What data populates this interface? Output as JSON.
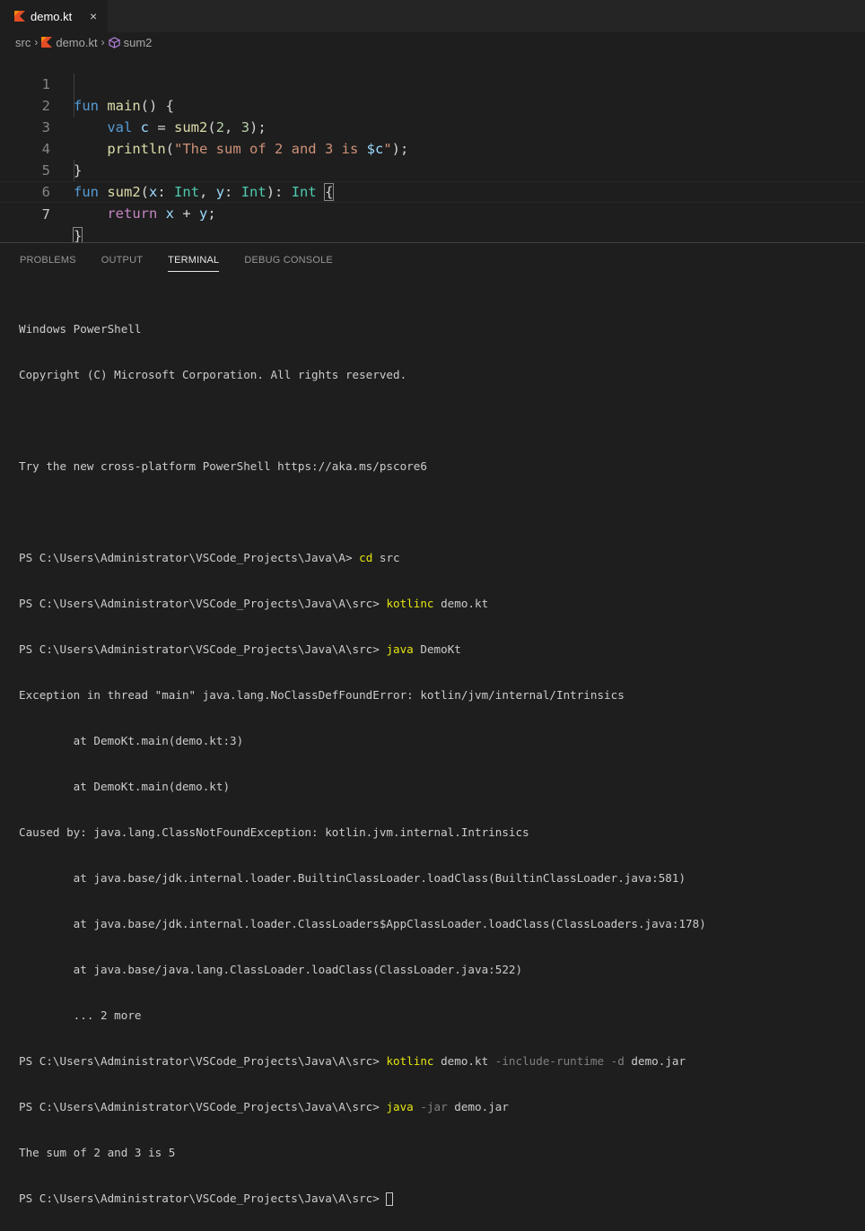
{
  "tab": {
    "title": "demo.kt",
    "close": "×"
  },
  "breadcrumb": {
    "folder": "src",
    "file": "demo.kt",
    "symbol": "sum2"
  },
  "editor": {
    "line_numbers": [
      "1",
      "2",
      "3",
      "4",
      "5",
      "6",
      "7"
    ],
    "tokens": {
      "l1_kw": "fun",
      "l1_fn": "main",
      "l1_rest": "() {",
      "l2_kw": "val",
      "l2_var": "c",
      "l2_eq": " = ",
      "l2_fn": "sum2",
      "l2_p1": "(",
      "l2_n1": "2",
      "l2_comma": ", ",
      "l2_n2": "3",
      "l2_end": ");",
      "l3_fn": "println",
      "l3_p": "(",
      "l3_str": "\"The sum of 2 and 3 is ",
      "l3_tmpl": "$c",
      "l3_strend": "\"",
      "l3_end": ");",
      "l4": "}",
      "l5_kw": "fun",
      "l5_fn": "sum2",
      "l5_p": "(",
      "l5_x": "x",
      "l5_c1": ": ",
      "l5_t1": "Int",
      "l5_comma": ", ",
      "l5_y": "y",
      "l5_c2": ": ",
      "l5_t2": "Int",
      "l5_close": "): ",
      "l5_t3": "Int",
      "l5_sp": " ",
      "l5_brace": "{",
      "l6_kw": "return",
      "l6_x": "x",
      "l6_plus": " + ",
      "l6_y": "y",
      "l6_end": ";",
      "l7": "}"
    }
  },
  "panel": {
    "tabs": [
      "PROBLEMS",
      "OUTPUT",
      "TERMINAL",
      "DEBUG CONSOLE"
    ],
    "active_tab": "TERMINAL"
  },
  "terminal": {
    "l1": "Windows PowerShell",
    "l2": "Copyright (C) Microsoft Corporation. All rights reserved.",
    "l3": "Try the new cross-platform PowerShell https://aka.ms/pscore6",
    "prompt_a": "PS C:\\Users\\Administrator\\VSCode_Projects\\Java\\A> ",
    "prompt_src": "PS C:\\Users\\Administrator\\VSCode_Projects\\Java\\A\\src> ",
    "c1_cmd": "cd",
    "c1_arg": " src",
    "c2_cmd": "kotlinc",
    "c2_arg": " demo.kt",
    "c3_cmd": "java",
    "c3_arg": " DemoKt",
    "e1": "Exception in thread \"main\" java.lang.NoClassDefFoundError: kotlin/jvm/internal/Intrinsics",
    "e2": "        at DemoKt.main(demo.kt:3)",
    "e3": "        at DemoKt.main(demo.kt)",
    "e4": "Caused by: java.lang.ClassNotFoundException: kotlin.jvm.internal.Intrinsics",
    "e5": "        at java.base/jdk.internal.loader.BuiltinClassLoader.loadClass(BuiltinClassLoader.java:581)",
    "e6": "        at java.base/jdk.internal.loader.ClassLoaders$AppClassLoader.loadClass(ClassLoaders.java:178)",
    "e7": "        at java.base/java.lang.ClassLoader.loadClass(ClassLoader.java:522)",
    "e8": "        ... 2 more",
    "c4_cmd": "kotlinc",
    "c4_arg1": " demo.kt ",
    "c4_flags": "-include-runtime -d",
    "c4_arg2": " demo.jar",
    "c5_cmd": "java",
    "c5_flag": " -jar",
    "c5_arg": " demo.jar",
    "out": "The sum of 2 and 3 is 5"
  }
}
